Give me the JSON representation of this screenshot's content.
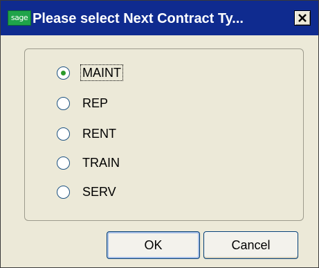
{
  "window": {
    "icon_text": "sage",
    "title": "Please select Next Contract Ty...",
    "close_glyph": "close-icon"
  },
  "radio_group": {
    "selected": "MAINT",
    "options": [
      {
        "label": "MAINT",
        "checked": true
      },
      {
        "label": "REP",
        "checked": false
      },
      {
        "label": "RENT",
        "checked": false
      },
      {
        "label": "TRAIN",
        "checked": false
      },
      {
        "label": "SERV",
        "checked": false
      }
    ]
  },
  "buttons": {
    "ok_label": "OK",
    "cancel_label": "Cancel"
  },
  "colors": {
    "titlebar": "#0f2b8f",
    "dialog_bg": "#ece9d8",
    "radio_dot": "#2a9a2a"
  }
}
